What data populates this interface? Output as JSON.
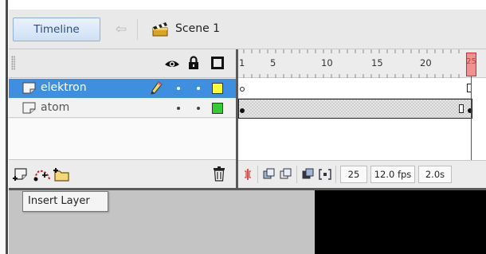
{
  "header": {
    "timeline_label": "Timeline",
    "scene_label": "Scene 1"
  },
  "layers": [
    {
      "name": "elektron",
      "selected": true,
      "outline_color": "#ffff33",
      "editing": true
    },
    {
      "name": "atom",
      "selected": false,
      "outline_color": "#33cc33",
      "editing": false
    }
  ],
  "ruler": {
    "frame_numbers": [
      "1",
      "5",
      "10",
      "15",
      "20",
      "25"
    ],
    "current_frame_marker": "25"
  },
  "footer": {
    "current_frame": "25",
    "frame_rate": "12.0 fps",
    "elapsed_time": "2.0s"
  },
  "tooltip": {
    "text": "Insert Layer"
  },
  "colors": {
    "selection": "#3f8fe0",
    "playhead": "#d02020",
    "timeline_button": "#cfe0f5"
  }
}
